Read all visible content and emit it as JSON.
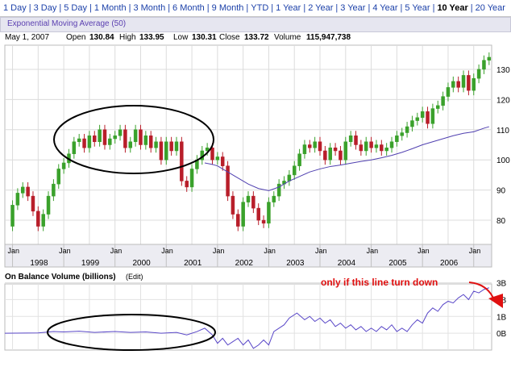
{
  "tabs": [
    {
      "label": "1 Day",
      "active": false
    },
    {
      "label": "3 Day",
      "active": false
    },
    {
      "label": "5 Day",
      "active": false
    },
    {
      "label": "1 Month",
      "active": false
    },
    {
      "label": "3 Month",
      "active": false
    },
    {
      "label": "6 Month",
      "active": false
    },
    {
      "label": "9 Month",
      "active": false
    },
    {
      "label": "YTD",
      "active": false
    },
    {
      "label": "1 Year",
      "active": false
    },
    {
      "label": "2 Year",
      "active": false
    },
    {
      "label": "3 Year",
      "active": false
    },
    {
      "label": "4 Year",
      "active": false
    },
    {
      "label": "5 Year",
      "active": false
    },
    {
      "label": "10 Year",
      "active": true
    },
    {
      "label": "20 Year",
      "active": false
    }
  ],
  "indicator": {
    "label": "Exponential Moving Average (50)"
  },
  "quote": {
    "date": "May 1, 2007",
    "open_label": "Open",
    "open": "130.84",
    "high_label": "High",
    "high": "133.95",
    "low_label": "Low",
    "low": "130.31",
    "close_label": "Close",
    "close": "133.72",
    "volume_label": "Volume",
    "volume": "115,947,738"
  },
  "obv_panel": {
    "title": "On Balance Volume (billions)",
    "edit": "(Edit)"
  },
  "annotation": "only if this line turn down",
  "colors": {
    "up": "#3aa12b",
    "down": "#b81e2a",
    "ema": "#5040b0",
    "obv": "#5a48c8",
    "annotation": "#e01010"
  },
  "chart_data": [
    {
      "type": "candlestick",
      "xlabel": "",
      "ylabel": "",
      "xlim": [
        1997.85,
        2007.35
      ],
      "ylim": [
        72,
        138
      ],
      "y_ticks": [
        80,
        90,
        100,
        110,
        120,
        130
      ],
      "x_tick_label": "Jan",
      "years": [
        "1998",
        "1999",
        "2000",
        "2001",
        "2002",
        "2003",
        "2004",
        "2005",
        "2006"
      ],
      "price": [
        [
          1997.85,
          78
        ],
        [
          1998.0,
          85
        ],
        [
          1998.1,
          89
        ],
        [
          1998.2,
          91
        ],
        [
          1998.3,
          88
        ],
        [
          1998.4,
          83
        ],
        [
          1998.5,
          78
        ],
        [
          1998.6,
          82
        ],
        [
          1998.7,
          88
        ],
        [
          1998.8,
          92
        ],
        [
          1998.9,
          97
        ],
        [
          1999.0,
          99
        ],
        [
          1999.1,
          102
        ],
        [
          1999.2,
          106
        ],
        [
          1999.3,
          107
        ],
        [
          1999.4,
          104
        ],
        [
          1999.5,
          108
        ],
        [
          1999.6,
          106
        ],
        [
          1999.7,
          110
        ],
        [
          1999.8,
          105
        ],
        [
          1999.9,
          107
        ],
        [
          2000.0,
          108
        ],
        [
          2000.1,
          110
        ],
        [
          2000.2,
          104
        ],
        [
          2000.3,
          106
        ],
        [
          2000.4,
          110
        ],
        [
          2000.5,
          105
        ],
        [
          2000.6,
          108
        ],
        [
          2000.7,
          104
        ],
        [
          2000.8,
          106
        ],
        [
          2000.9,
          100
        ],
        [
          2001.0,
          106
        ],
        [
          2001.1,
          103
        ],
        [
          2001.2,
          106
        ],
        [
          2001.3,
          93
        ],
        [
          2001.4,
          91
        ],
        [
          2001.5,
          97
        ],
        [
          2001.6,
          100
        ],
        [
          2001.7,
          103
        ],
        [
          2001.8,
          104
        ],
        [
          2001.9,
          100
        ],
        [
          2002.0,
          101
        ],
        [
          2002.1,
          98
        ],
        [
          2002.2,
          88
        ],
        [
          2002.3,
          82
        ],
        [
          2002.4,
          78
        ],
        [
          2002.5,
          86
        ],
        [
          2002.6,
          88
        ],
        [
          2002.7,
          84
        ],
        [
          2002.8,
          80
        ],
        [
          2002.9,
          79
        ],
        [
          2003.0,
          86
        ],
        [
          2003.1,
          88
        ],
        [
          2003.2,
          92
        ],
        [
          2003.3,
          93
        ],
        [
          2003.4,
          95
        ],
        [
          2003.5,
          98
        ],
        [
          2003.6,
          102
        ],
        [
          2003.7,
          105
        ],
        [
          2003.8,
          104
        ],
        [
          2003.9,
          106
        ],
        [
          2004.0,
          103
        ],
        [
          2004.1,
          100
        ],
        [
          2004.2,
          104
        ],
        [
          2004.3,
          103
        ],
        [
          2004.4,
          100
        ],
        [
          2004.5,
          106
        ],
        [
          2004.6,
          108
        ],
        [
          2004.7,
          105
        ],
        [
          2004.8,
          103
        ],
        [
          2004.9,
          106
        ],
        [
          2005.0,
          104
        ],
        [
          2005.1,
          105
        ],
        [
          2005.2,
          103
        ],
        [
          2005.3,
          104
        ],
        [
          2005.4,
          106
        ],
        [
          2005.5,
          108
        ],
        [
          2005.6,
          109
        ],
        [
          2005.7,
          111
        ],
        [
          2005.8,
          113
        ],
        [
          2005.9,
          114
        ],
        [
          2006.0,
          116
        ],
        [
          2006.1,
          112
        ],
        [
          2006.2,
          117
        ],
        [
          2006.3,
          118
        ],
        [
          2006.4,
          121
        ],
        [
          2006.5,
          124
        ],
        [
          2006.6,
          126
        ],
        [
          2006.7,
          124
        ],
        [
          2006.8,
          128
        ],
        [
          2006.9,
          123
        ],
        [
          2007.0,
          127
        ],
        [
          2007.1,
          130
        ],
        [
          2007.2,
          133
        ],
        [
          2007.3,
          134
        ]
      ],
      "ema50": [
        [
          2001.75,
          99
        ],
        [
          2001.9,
          98.5
        ],
        [
          2002.0,
          98
        ],
        [
          2002.2,
          96
        ],
        [
          2002.4,
          94
        ],
        [
          2002.6,
          92
        ],
        [
          2002.8,
          90.5
        ],
        [
          2003.0,
          89.8
        ],
        [
          2003.2,
          91
        ],
        [
          2003.4,
          93
        ],
        [
          2003.6,
          94.5
        ],
        [
          2003.8,
          96
        ],
        [
          2004.0,
          97
        ],
        [
          2004.2,
          97.8
        ],
        [
          2004.4,
          98.3
        ],
        [
          2004.6,
          98.9
        ],
        [
          2004.8,
          99.5
        ],
        [
          2005.0,
          100
        ],
        [
          2005.2,
          100.7
        ],
        [
          2005.4,
          101.5
        ],
        [
          2005.6,
          102.5
        ],
        [
          2005.8,
          103.7
        ],
        [
          2006.0,
          105
        ],
        [
          2006.2,
          106
        ],
        [
          2006.4,
          107
        ],
        [
          2006.6,
          108
        ],
        [
          2006.8,
          108.8
        ],
        [
          2007.0,
          109.3
        ],
        [
          2007.2,
          110.5
        ],
        [
          2007.3,
          111
        ]
      ]
    },
    {
      "type": "line",
      "name": "On Balance Volume",
      "xlabel": "",
      "ylabel": "",
      "xlim": [
        1997.85,
        2007.35
      ],
      "ylim": [
        -1.0,
        3.6
      ],
      "y_ticks": [
        0,
        1,
        2,
        3
      ],
      "y_tick_labels": [
        "0B",
        "1B",
        "2B",
        "3B"
      ],
      "values": [
        [
          1997.85,
          0
        ],
        [
          1998.5,
          0.02
        ],
        [
          1998.8,
          0.1
        ],
        [
          1999.0,
          0.08
        ],
        [
          1999.3,
          0.12
        ],
        [
          1999.6,
          0.05
        ],
        [
          2000.0,
          0.1
        ],
        [
          2000.3,
          0.05
        ],
        [
          2000.6,
          0.08
        ],
        [
          2000.9,
          0.0
        ],
        [
          2001.2,
          0.05
        ],
        [
          2001.4,
          -0.1
        ],
        [
          2001.6,
          0.1
        ],
        [
          2001.75,
          0.3
        ],
        [
          2001.9,
          -0.1
        ],
        [
          2002.0,
          -0.6
        ],
        [
          2002.1,
          -0.3
        ],
        [
          2002.2,
          -0.7
        ],
        [
          2002.3,
          -0.5
        ],
        [
          2002.4,
          -0.3
        ],
        [
          2002.5,
          -0.7
        ],
        [
          2002.6,
          -0.4
        ],
        [
          2002.7,
          -0.9
        ],
        [
          2002.8,
          -0.7
        ],
        [
          2002.9,
          -0.4
        ],
        [
          2003.0,
          -0.7
        ],
        [
          2003.1,
          0.1
        ],
        [
          2003.3,
          0.5
        ],
        [
          2003.4,
          0.9
        ],
        [
          2003.55,
          1.2
        ],
        [
          2003.7,
          0.8
        ],
        [
          2003.8,
          1.0
        ],
        [
          2003.9,
          0.7
        ],
        [
          2004.0,
          0.9
        ],
        [
          2004.1,
          0.6
        ],
        [
          2004.2,
          0.8
        ],
        [
          2004.3,
          0.4
        ],
        [
          2004.4,
          0.6
        ],
        [
          2004.5,
          0.3
        ],
        [
          2004.6,
          0.5
        ],
        [
          2004.7,
          0.2
        ],
        [
          2004.8,
          0.4
        ],
        [
          2004.9,
          0.1
        ],
        [
          2005.0,
          0.3
        ],
        [
          2005.1,
          0.1
        ],
        [
          2005.2,
          0.4
        ],
        [
          2005.3,
          0.2
        ],
        [
          2005.4,
          0.5
        ],
        [
          2005.5,
          0.1
        ],
        [
          2005.6,
          0.3
        ],
        [
          2005.7,
          0.1
        ],
        [
          2005.8,
          0.5
        ],
        [
          2005.9,
          0.8
        ],
        [
          2006.0,
          0.6
        ],
        [
          2006.1,
          1.2
        ],
        [
          2006.2,
          1.5
        ],
        [
          2006.3,
          1.3
        ],
        [
          2006.4,
          1.7
        ],
        [
          2006.5,
          1.9
        ],
        [
          2006.6,
          1.8
        ],
        [
          2006.7,
          2.1
        ],
        [
          2006.8,
          2.3
        ],
        [
          2006.9,
          2.0
        ],
        [
          2007.0,
          2.5
        ],
        [
          2007.1,
          2.4
        ],
        [
          2007.2,
          2.6
        ],
        [
          2007.3,
          2.7
        ]
      ]
    }
  ]
}
